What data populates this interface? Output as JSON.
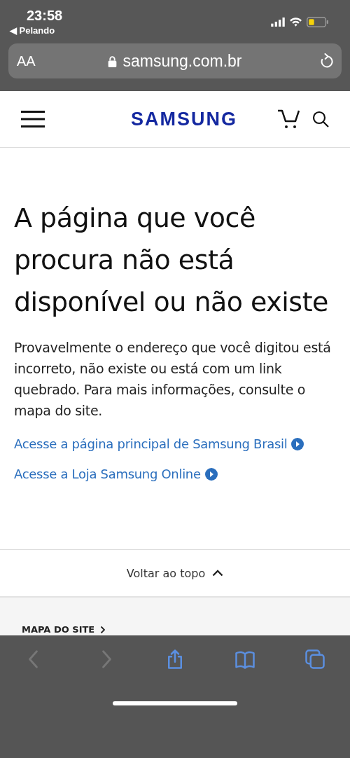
{
  "status_bar": {
    "time": "23:58",
    "back_app": "◀ Pelando"
  },
  "address_bar": {
    "text_size": "AA",
    "url": "samsung.com.br"
  },
  "header": {
    "logo": "SAMSUNG"
  },
  "main": {
    "title": "A página que você procura não está disponível ou não existe",
    "message": "Provavelmente o endereço que você digitou está incorreto, não existe ou está com um link quebrado. Para mais informações, consulte o mapa do site.",
    "links": [
      "Acesse a página principal de Samsung Brasil",
      "Acesse a Loja Samsung Online"
    ]
  },
  "back_to_top": "Voltar ao topo",
  "footer": {
    "sitemap": "MAPA DO SITE"
  },
  "toolbar": [
    {
      "kind": "back",
      "disabled": true
    },
    {
      "kind": "forward",
      "disabled": true
    },
    {
      "kind": "share",
      "disabled": false
    },
    {
      "kind": "bookmarks",
      "disabled": false
    },
    {
      "kind": "tabs",
      "disabled": false
    }
  ]
}
